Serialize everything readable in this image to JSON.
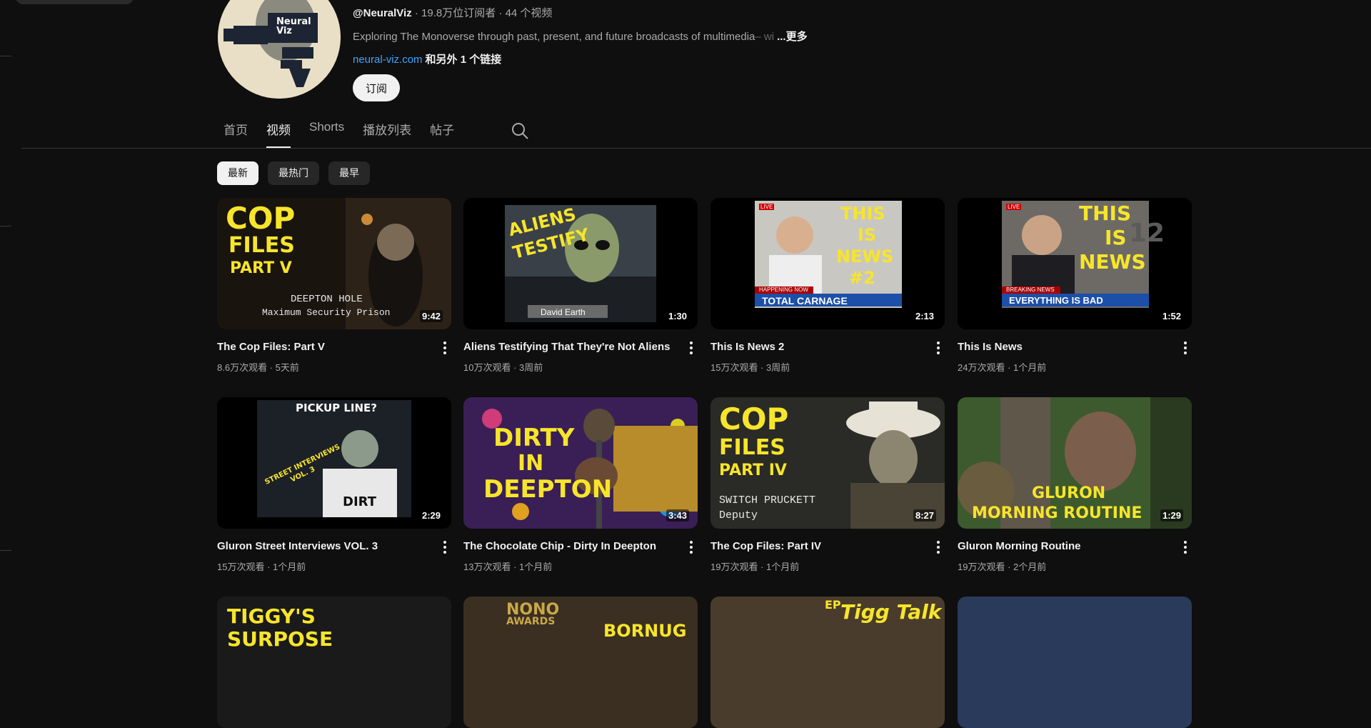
{
  "channel": {
    "handle": "@NeuralViz",
    "stats": " · 19.8万位订阅者 · 44 个视频",
    "description": "Exploring The Monoverse through past, present, and future broadcasts of multimedia",
    "description_fade": "– wi",
    "more_label": "...更多",
    "link": "neural-viz.com",
    "link_rest": "和另外 1 个链接",
    "subscribe_label": "订阅",
    "avatar_text": "Neural Viz"
  },
  "tabs": [
    {
      "label": "首页"
    },
    {
      "label": "视频"
    },
    {
      "label": "Shorts"
    },
    {
      "label": "播放列表"
    },
    {
      "label": "帖子"
    }
  ],
  "active_tab": "视频",
  "chips": [
    {
      "label": "最新"
    },
    {
      "label": "最热门"
    },
    {
      "label": "最早"
    }
  ],
  "videos": [
    {
      "title": "The Cop Files: Part V",
      "meta": "8.6万次观看 · 5天前",
      "duration": "9:42",
      "thumb_text": [
        "COP",
        "FILES",
        "PART V",
        "DEEPTON HOLE",
        "Maximum Security Prison"
      ]
    },
    {
      "title": "Aliens Testifying That They're Not Aliens",
      "meta": "10万次观看 · 3周前",
      "duration": "1:30",
      "thumb_text": [
        "ALIENS",
        "TESTIFY",
        "David Earth"
      ]
    },
    {
      "title": "This Is News 2",
      "meta": "15万次观看 · 3周前",
      "duration": "2:13",
      "thumb_text": [
        "THIS",
        "IS",
        "NEWS",
        "#2",
        "HAPPENING NOW",
        "TOTAL CARNAGE",
        "LIVE"
      ]
    },
    {
      "title": "This Is News",
      "meta": "24万次观看 · 1个月前",
      "duration": "1:52",
      "thumb_text": [
        "THIS",
        "IS",
        "NEWS",
        "12",
        "BREAKING NEWS",
        "EVERYTHING IS BAD",
        "LIVE"
      ]
    },
    {
      "title": "Gluron Street Interviews VOL. 3",
      "meta": "15万次观看 · 1个月前",
      "duration": "2:29",
      "thumb_text": [
        "PICKUP LINE?",
        "STREET INTERVIEWS",
        "VOL. 3",
        "DIRT"
      ]
    },
    {
      "title": "The Chocolate Chip - Dirty In Deepton",
      "meta": "13万次观看 · 1个月前",
      "duration": "3:43",
      "thumb_text": [
        "DIRTY",
        "IN",
        "DEEPTON"
      ]
    },
    {
      "title": "The Cop Files: Part IV",
      "meta": "19万次观看 · 1个月前",
      "duration": "8:27",
      "thumb_text": [
        "COP",
        "FILES",
        "PART IV",
        "SWITCH PRUCKETT",
        "Deputy"
      ]
    },
    {
      "title": "Gluron Morning Routine",
      "meta": "19万次观看 · 2个月前",
      "duration": "1:29",
      "thumb_text": [
        "GLURON",
        "MORNING ROUTINE"
      ]
    }
  ],
  "partial_row": [
    {
      "thumb_text": [
        "TIGGY'S",
        "SURPOSE"
      ]
    },
    {
      "thumb_text": [
        "NONO",
        "AWARDS",
        "BORNUG"
      ]
    },
    {
      "thumb_text": [
        "EP",
        "Tigg Talk"
      ]
    },
    {
      "thumb_text": []
    }
  ],
  "colors": {
    "background": "#0f0f0f",
    "accent_link": "#3ea6ff",
    "thumb_yellow": "#f7e52b"
  },
  "icons": {
    "search": "search-icon",
    "more": "kebab-menu-icon"
  }
}
